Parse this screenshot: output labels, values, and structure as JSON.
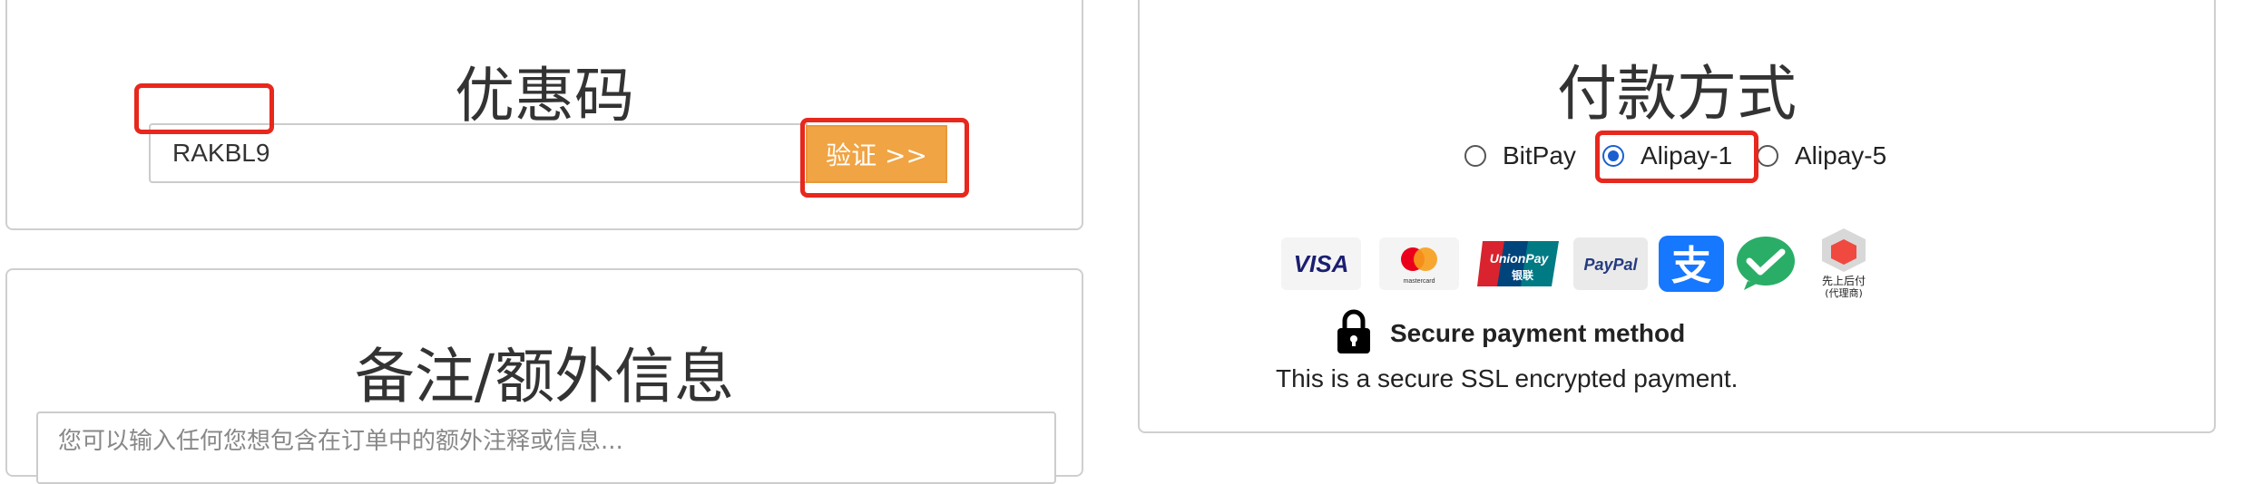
{
  "coupon": {
    "title": "优惠码",
    "input_value": "RAKBL9",
    "verify_label": "验证 >>"
  },
  "notes": {
    "title": "备注/额外信息",
    "placeholder": "您可以输入任何您想包含在订单中的额外注释或信息..."
  },
  "payment": {
    "title": "付款方式",
    "options": [
      {
        "label": "BitPay",
        "checked": false
      },
      {
        "label": "Alipay-1",
        "checked": true
      },
      {
        "label": "Alipay-5",
        "checked": false
      }
    ],
    "logos": [
      {
        "name": "visa-logo",
        "text": "VISA"
      },
      {
        "name": "mastercard-logo",
        "text": "mastercard"
      },
      {
        "name": "unionpay-logo",
        "text": "UnionPay",
        "subtext": "银联"
      },
      {
        "name": "paypal-logo",
        "text": "PayPal"
      },
      {
        "name": "alipay-logo",
        "text": "支"
      },
      {
        "name": "wechat-pay-logo",
        "text": ""
      },
      {
        "name": "pay-later-logo",
        "text": "先上后付",
        "subtext": "(代理商)"
      }
    ],
    "secure_heading": "Secure payment method",
    "secure_text": "This is a secure SSL encrypted payment."
  },
  "colors": {
    "highlight": "#e8271d",
    "verify_button": "#f0a443",
    "radio_checked": "#1a5fd0",
    "alipay_blue": "#1677ff",
    "wechat_green": "#2aae67"
  }
}
